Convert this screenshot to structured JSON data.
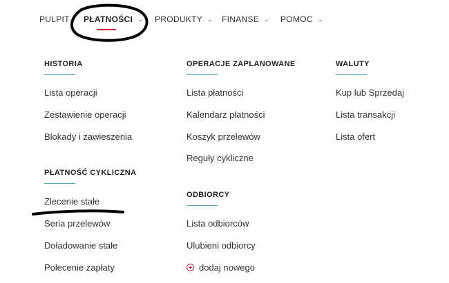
{
  "nav": {
    "items": [
      {
        "label": "PULPIT",
        "has_chevron": false,
        "active": false
      },
      {
        "label": "PŁATNOŚCI",
        "has_chevron": true,
        "active": true
      },
      {
        "label": "PRODUKTY",
        "has_chevron": true,
        "active": false
      },
      {
        "label": "FINANSE",
        "has_chevron": true,
        "active": false
      },
      {
        "label": "POMOC",
        "has_chevron": true,
        "active": false
      }
    ],
    "chevron_icon": "chevron-down-icon",
    "accent_color": "#d6243a"
  },
  "menu": {
    "historia": {
      "title": "HISTORIA",
      "links": [
        "Lista operacji",
        "Zestawienie operacji",
        "Blokady i zawieszenia"
      ]
    },
    "platnosc_cykliczna": {
      "title": "PŁATNOŚĆ CYKLICZNA",
      "links": [
        "Zlecenie stałe",
        "Seria przelewów",
        "Doładowanie stałe",
        "Polecenie zapłaty"
      ]
    },
    "operacje_zaplanowane": {
      "title": "OPERACJE ZAPLANOWANE",
      "links": [
        "Lista płatności",
        "Kalendarz płatności",
        "Koszyk przelewów",
        "Reguły cykliczne"
      ]
    },
    "odbiorcy": {
      "title": "ODBIORCY",
      "links": [
        "Lista odbiorców",
        "Ulubieni odbiorcy"
      ],
      "add_label": "dodaj nowego",
      "add_icon": "plus-circle-icon"
    },
    "waluty": {
      "title": "WALUTY",
      "links": [
        "Kup lub Sprzedaj",
        "Lista transakcji",
        "Lista ofert"
      ]
    }
  },
  "colors": {
    "section_rule": "#5aa0d0",
    "text": "#333333",
    "annotation": "#000000"
  }
}
